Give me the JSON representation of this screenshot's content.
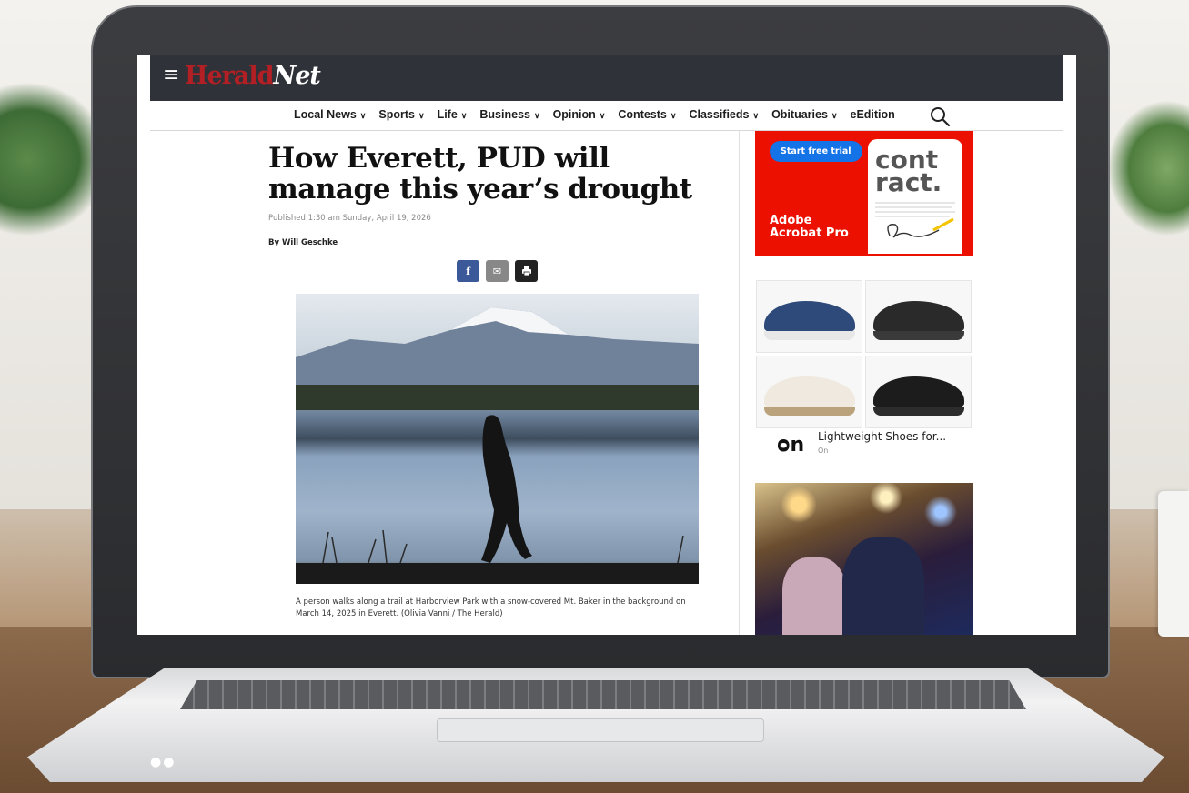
{
  "site": {
    "logo_herald": "Herald",
    "logo_net": "Net",
    "menu_icon": "menu-icon"
  },
  "nav": {
    "items": [
      {
        "label": "Local News",
        "has_dropdown": true
      },
      {
        "label": "Sports",
        "has_dropdown": true
      },
      {
        "label": "Life",
        "has_dropdown": true
      },
      {
        "label": "Business",
        "has_dropdown": true
      },
      {
        "label": "Opinion",
        "has_dropdown": true
      },
      {
        "label": "Contests",
        "has_dropdown": true
      },
      {
        "label": "Classifieds",
        "has_dropdown": true
      },
      {
        "label": "Obituaries",
        "has_dropdown": true
      },
      {
        "label": "eEdition",
        "has_dropdown": false
      }
    ],
    "search_icon": "search-icon"
  },
  "article": {
    "headline": "How Everett, PUD will manage this year’s drought",
    "published": "Published 1:30 am Sunday, April 19, 2026",
    "byline": "By Will Geschke",
    "share": {
      "facebook": "f",
      "email": "✉",
      "print": "🖶"
    },
    "caption": "A person walks along a trail at Harborview Park with a snow-covered Mt. Baker in the background on March 14, 2025 in Everett. (Olivia Vanni / The Herald)"
  },
  "ads": {
    "adobe": {
      "cta": "Start free trial",
      "brand_line1": "Adobe",
      "brand_line2": "Acrobat Pro",
      "doc_title": "cont\nract.",
      "accent": "#eb1000"
    },
    "shoes": {
      "title": "Lightweight Shoes for...",
      "advertiser": "On",
      "logo": "ᴑn"
    }
  },
  "colors": {
    "header_bg": "#2f3238",
    "logo_red": "#b21f24",
    "facebook": "#3b5998"
  }
}
